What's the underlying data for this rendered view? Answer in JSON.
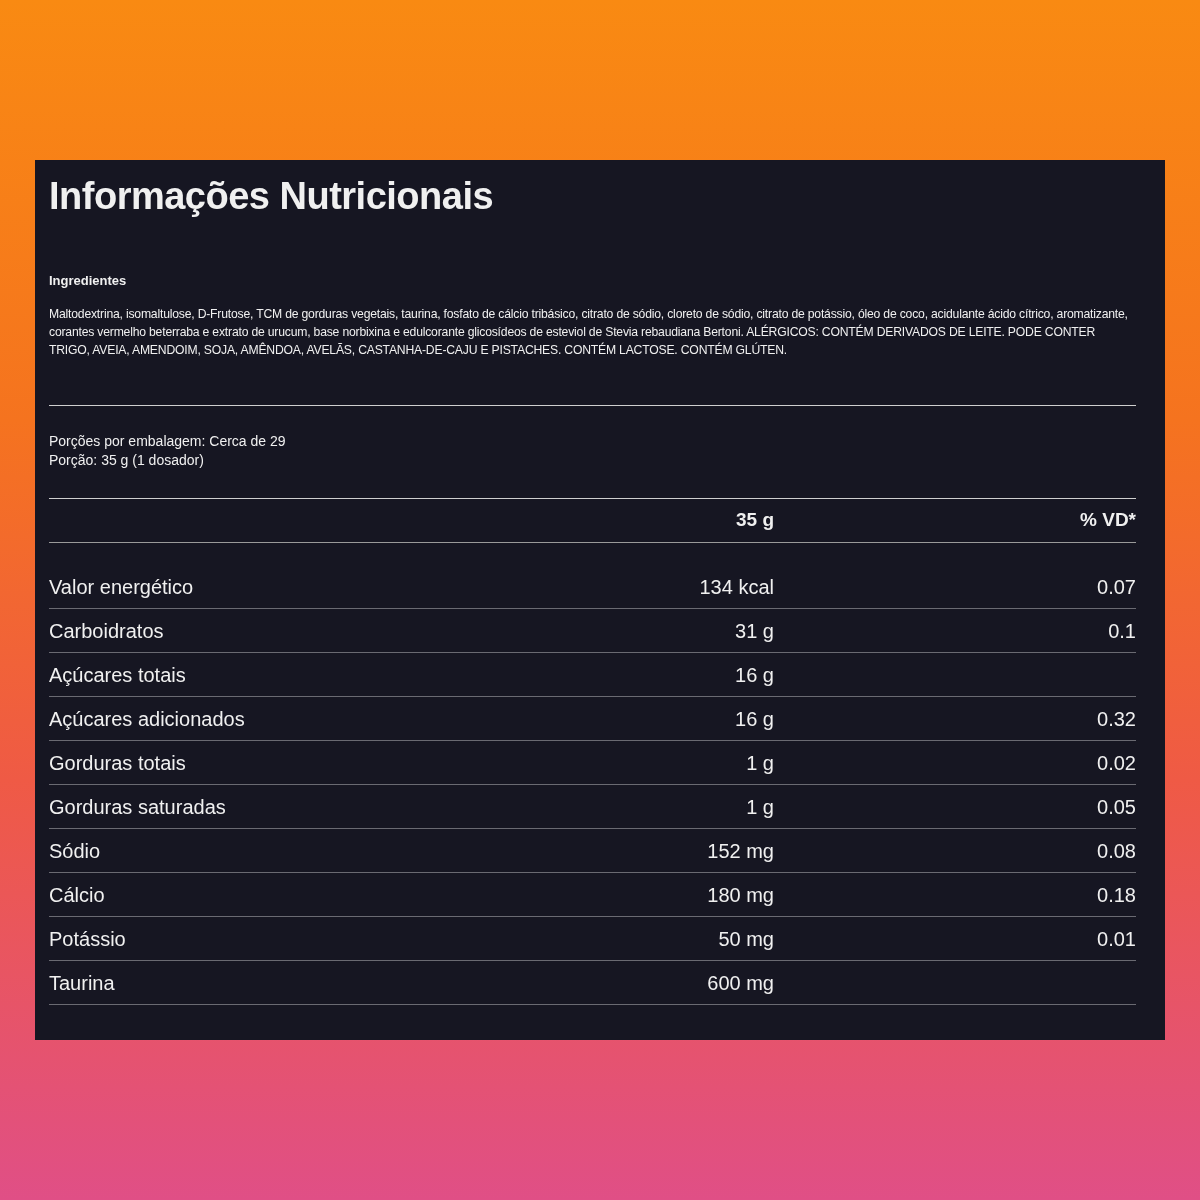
{
  "title": "Informações Nutricionais",
  "ingredients": {
    "heading": "Ingredientes",
    "text": "Maltodextrina, isomaltulose, D-Frutose, TCM de gorduras vegetais, taurina, fosfato de cálcio tribásico, citrato de sódio, cloreto de sódio, citrato de potássio, óleo de coco, acidulante ácido cítrico, aromatizante, corantes vermelho beterraba e extrato de urucum, base norbixina e edulcorante glicosídeos de esteviol de Stevia rebaudiana Bertoni. ALÉRGICOS: CONTÉM DERIVADOS DE LEITE. PODE CONTER TRIGO, AVEIA, AMENDOIM, SOJA, AMÊNDOA, AVELÃS, CASTANHA-DE-CAJU E PISTACHES. CONTÉM LACTOSE. CONTÉM GLÚTEN."
  },
  "servings": [
    "Porções por embalagem: Cerca de 29",
    "Porção: 35 g (1 dosador)"
  ],
  "table": {
    "columns": [
      "35 g",
      "% VD*"
    ],
    "rows": [
      {
        "name": "Valor energético",
        "amount": "134 kcal",
        "dv": "0.07"
      },
      {
        "name": "Carboidratos",
        "amount": "31 g",
        "dv": "0.1"
      },
      {
        "name": "Açúcares totais",
        "amount": "16 g"
      },
      {
        "name": "Açúcares adicionados",
        "amount": "16 g",
        "dv": "0.32"
      },
      {
        "name": "Gorduras totais",
        "amount": "1 g",
        "dv": "0.02"
      },
      {
        "name": "Gorduras saturadas",
        "amount": "1 g",
        "dv": "0.05"
      },
      {
        "name": "Sódio",
        "amount": "152 mg",
        "dv": "0.08"
      },
      {
        "name": "Cálcio",
        "amount": "180 mg",
        "dv": "0.18"
      },
      {
        "name": "Potássio",
        "amount": "50 mg",
        "dv": "0.01"
      },
      {
        "name": "Taurina",
        "amount": "600 mg"
      }
    ]
  }
}
